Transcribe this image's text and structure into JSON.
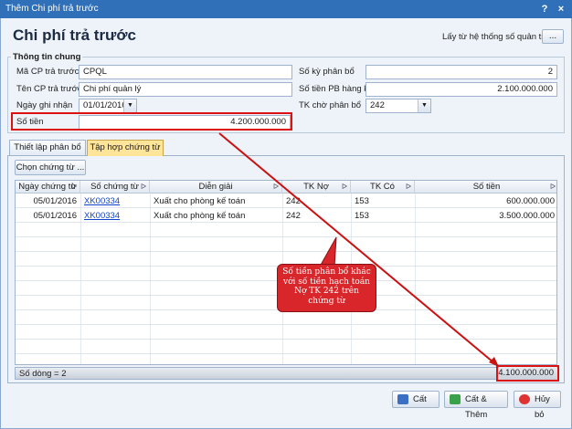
{
  "window": {
    "title": "Thêm Chi phí trả trước",
    "help": "?",
    "close": "×"
  },
  "header": {
    "title": "Chi phí trả trước",
    "system_params_label": "Lấy từ hệ thống số quản trị",
    "ellipsis": "..."
  },
  "general": {
    "group_title": "Thông tin chung",
    "code_label": "Mã CP trả trước",
    "code_value": "CPQL",
    "name_label": "Tên CP trả trước",
    "name_value": "Chi phí quản lý",
    "date_label": "Ngày ghi nhận",
    "date_value": "01/01/2016",
    "amount_label": "Số tiền",
    "amount_value": "4.200.000.000",
    "periods_label": "Số kỳ phân bổ",
    "periods_value": "2",
    "per_period_label": "Số tiền PB hàng kỳ",
    "per_period_value": "2.100.000.000",
    "account_label": "TK chờ phân bổ",
    "account_value": "242"
  },
  "tabs": [
    {
      "label": "Thiết lập phân bổ"
    },
    {
      "label": "Tập hợp chứng từ"
    }
  ],
  "choose_button": "Chọn chứng từ ...",
  "grid": {
    "columns": [
      "Ngày chứng từ",
      "Số chứng từ",
      "Diễn giải",
      "TK Nợ",
      "TK Có",
      "Số tiền"
    ],
    "rows": [
      {
        "date": "05/01/2016",
        "doc": "XK00334",
        "desc": "Xuất cho phòng kế toán",
        "debit": "242",
        "credit": "153",
        "amount": "600.000.000"
      },
      {
        "date": "05/01/2016",
        "doc": "XK00334",
        "desc": "Xuất cho phòng kế toán",
        "debit": "242",
        "credit": "153",
        "amount": "3.500.000.000"
      }
    ],
    "footer_count": "Số dòng = 2",
    "footer_total": "4.100.000.000"
  },
  "callout": {
    "text": "Số tiền phân bổ khác với số tiền hạch toán Nợ TK 242 trên chứng từ"
  },
  "buttons": {
    "save": "Cất",
    "save_add": "Cất & Thêm",
    "cancel": "Hủy bỏ"
  },
  "colors": {
    "titlebar": "#2f70b8",
    "active_tab": "#ffe59a",
    "highlight": "#dd1111",
    "callout": "#d8262b"
  }
}
